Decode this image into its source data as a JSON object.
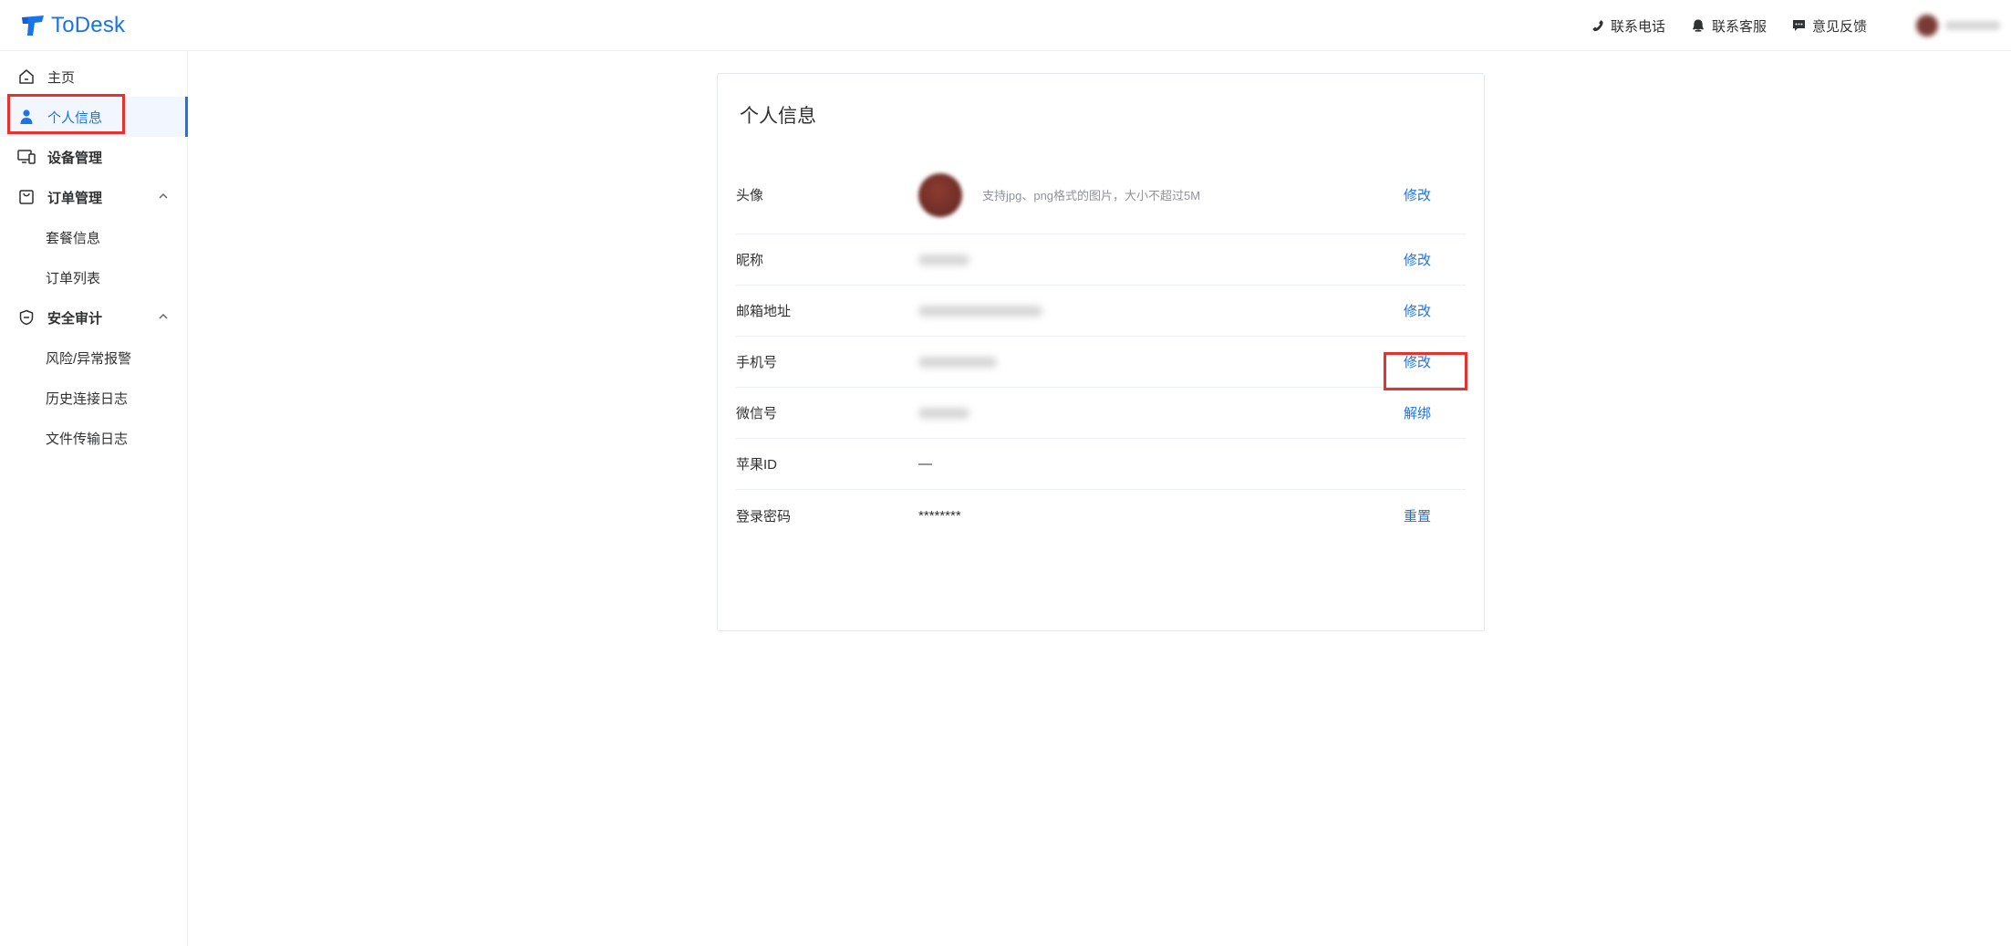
{
  "header": {
    "logo_text": "ToDesk",
    "actions": [
      {
        "label": "联系电话",
        "icon": "phone-icon"
      },
      {
        "label": "联系客服",
        "icon": "customer-service-icon"
      },
      {
        "label": "意见反馈",
        "icon": "feedback-icon"
      }
    ]
  },
  "sidebar": {
    "items": [
      {
        "label": "主页",
        "icon": "home-icon"
      },
      {
        "label": "个人信息",
        "icon": "user-icon",
        "active": true
      },
      {
        "label": "设备管理",
        "icon": "devices-icon"
      },
      {
        "label": "订单管理",
        "icon": "shopping-bag-icon",
        "expanded": true,
        "children": [
          {
            "label": "套餐信息"
          },
          {
            "label": "订单列表"
          }
        ]
      },
      {
        "label": "安全审计",
        "icon": "shield-icon",
        "expanded": true,
        "children": [
          {
            "label": "风险/异常报警"
          },
          {
            "label": "历史连接日志"
          },
          {
            "label": "文件传输日志"
          }
        ]
      }
    ]
  },
  "main": {
    "title": "个人信息",
    "rows": [
      {
        "label": "头像",
        "hint": "支持jpg、png格式的图片，大小不超过5M",
        "action": "修改"
      },
      {
        "label": "昵称",
        "action": "修改"
      },
      {
        "label": "邮箱地址",
        "action": "修改"
      },
      {
        "label": "手机号",
        "action": "修改"
      },
      {
        "label": "微信号",
        "action": "解绑"
      },
      {
        "label": "苹果ID",
        "value": "—"
      },
      {
        "label": "登录密码",
        "value": "********",
        "action": "重置"
      }
    ]
  },
  "colors": {
    "accent": "#1a73e8",
    "highlight_box": "#e5322d",
    "active_bg": "#f2f7ff"
  }
}
